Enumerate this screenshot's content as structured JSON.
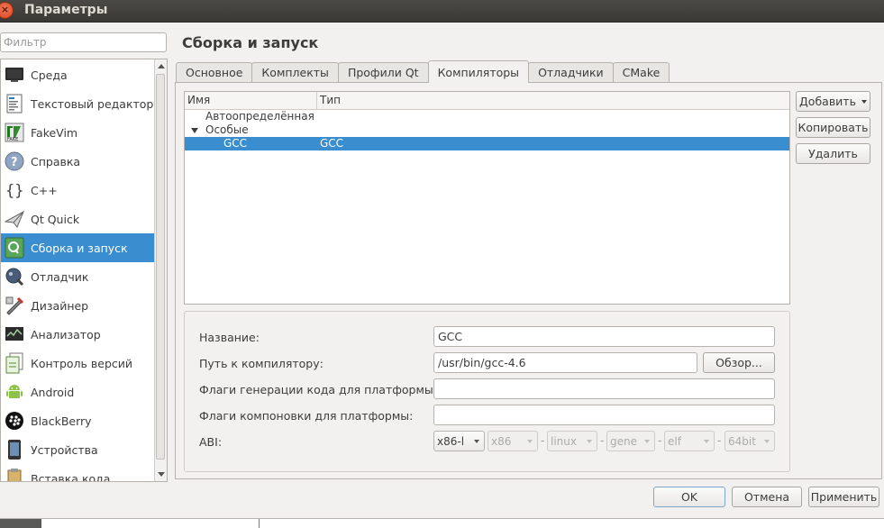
{
  "window": {
    "title": "Параметры",
    "close_glyph": "×"
  },
  "filter": {
    "placeholder": "Фильтр"
  },
  "sidebar": {
    "items": [
      {
        "label": "Среда",
        "icon": "monitor-icon"
      },
      {
        "label": "Текстовый редактор",
        "icon": "text-editor-icon"
      },
      {
        "label": "FakeVim",
        "icon": "fakevim-icon"
      },
      {
        "label": "Справка",
        "icon": "help-icon"
      },
      {
        "label": "C++",
        "icon": "braces-icon"
      },
      {
        "label": "Qt Quick",
        "icon": "paper-plane-icon"
      },
      {
        "label": "Сборка и запуск",
        "icon": "build-run-icon",
        "active": true
      },
      {
        "label": "Отладчик",
        "icon": "debugger-icon"
      },
      {
        "label": "Дизайнер",
        "icon": "designer-icon"
      },
      {
        "label": "Анализатор",
        "icon": "analyzer-icon"
      },
      {
        "label": "Контроль версий",
        "icon": "version-control-icon"
      },
      {
        "label": "Android",
        "icon": "android-icon"
      },
      {
        "label": "BlackBerry",
        "icon": "blackberry-icon"
      },
      {
        "label": "Устройства",
        "icon": "devices-icon"
      },
      {
        "label": "Вставка кода",
        "icon": "code-paste-icon"
      }
    ]
  },
  "page": {
    "title": "Сборка и запуск"
  },
  "tabs": [
    {
      "label": "Основное"
    },
    {
      "label": "Комплекты"
    },
    {
      "label": "Профили Qt"
    },
    {
      "label": "Компиляторы",
      "active": true
    },
    {
      "label": "Отладчики"
    },
    {
      "label": "CMake"
    }
  ],
  "tree": {
    "columns": {
      "name": "Имя",
      "type": "Тип"
    },
    "rows": [
      {
        "name": "Автоопределённая",
        "type": ""
      },
      {
        "name": "Особые",
        "type": ""
      },
      {
        "name": "GCC",
        "type": "GCC"
      }
    ]
  },
  "actions": {
    "add": "Добавить",
    "copy": "Копировать",
    "remove": "Удалить"
  },
  "details": {
    "name_label": "Название:",
    "name_value": "GCC",
    "path_label": "Путь к компилятору:",
    "path_value": "/usr/bin/gcc-4.6",
    "browse": "Обзор...",
    "codegen_flags_label": "Флаги генерации кода для платформы:",
    "codegen_flags_value": "",
    "link_flags_label": "Флаги компоновки для платформы:",
    "link_flags_value": "",
    "abi_label": "ABI:",
    "abi": [
      "x86-l",
      "x86",
      "linux",
      "gene",
      "elf",
      "64bit"
    ],
    "abi_sep": "-"
  },
  "footer": {
    "ok": "OK",
    "cancel": "Отмена",
    "apply": "Применить"
  },
  "colors": {
    "selection": "#3a8dce",
    "titlebar": "#3c3b37",
    "close": "#e05a2f"
  }
}
